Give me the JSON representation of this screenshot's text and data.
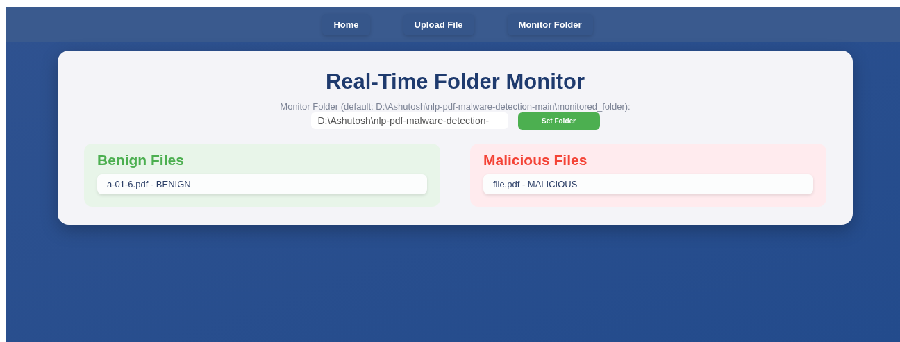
{
  "nav": {
    "items": [
      {
        "label": "Home"
      },
      {
        "label": "Upload File"
      },
      {
        "label": "Monitor Folder"
      }
    ]
  },
  "monitor": {
    "title": "Real-Time Folder Monitor",
    "folder_label": "Monitor Folder (default: D:\\Ashutosh\\nlp-pdf-malware-detection-main\\monitored_folder):",
    "folder_input": {
      "value": "D:\\Ashutosh\\nlp-pdf-malware-detection-"
    },
    "set_button": "Set Folder",
    "panels": [
      {
        "kind": "benign",
        "title": "Benign Files",
        "files": [
          "a-01-6.pdf - BENIGN"
        ]
      },
      {
        "kind": "malicious",
        "title": "Malicious Files",
        "files": [
          "file.pdf - MALICIOUS"
        ]
      }
    ]
  }
}
